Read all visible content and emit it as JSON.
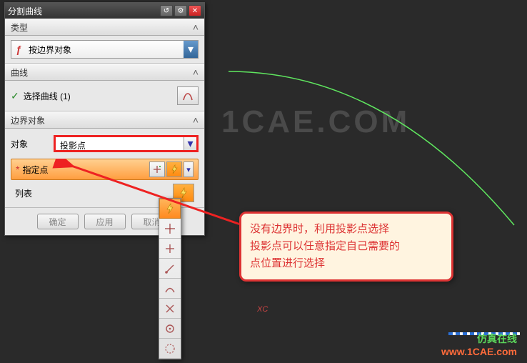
{
  "panel": {
    "title": "分割曲线",
    "type_section": {
      "header": "类型",
      "option": "按边界对象"
    },
    "curve_section": {
      "header": "曲线",
      "select_label": "选择曲线 (1)"
    },
    "boundary_section": {
      "header": "边界对象",
      "object_label": "对象",
      "object_value": "投影点",
      "specify_label": "指定点",
      "list_label": "列表"
    },
    "footer": {
      "ok": "确定",
      "apply": "应用",
      "cancel": "取消"
    }
  },
  "annotation": {
    "line1": "没有边界时，利用投影点选择",
    "line2": "投影点可以任意指定自己需要的",
    "line3": "点位置进行选择"
  },
  "axis_label": "XC",
  "watermark": {
    "big": "1CAE.COM",
    "line1": "仿真在线",
    "line2": "www.1CAE.com"
  }
}
